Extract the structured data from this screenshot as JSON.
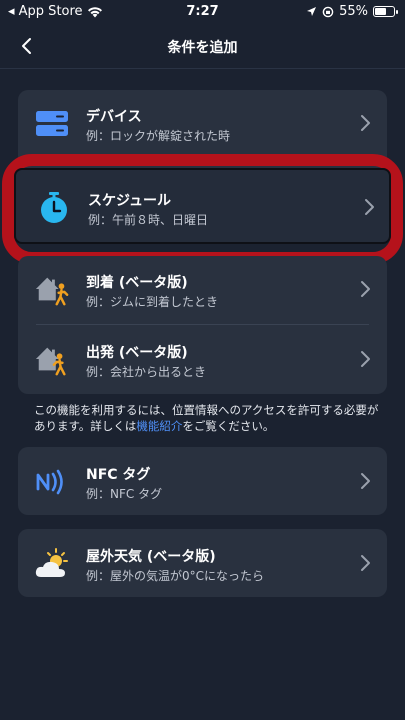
{
  "status_bar": {
    "carrier": "◂ App Store",
    "time": "7:27",
    "battery_percent": "55%",
    "battery_level": 0.55
  },
  "nav": {
    "title": "条件を追加",
    "back_icon": "chevron-left-icon"
  },
  "group1": [
    {
      "title": "デバイス",
      "subtitle": "例：ロックが解錠された時",
      "icon": "device-icon"
    }
  ],
  "highlighted": {
    "title": "スケジュール",
    "subtitle": "例：午前８時、日曜日",
    "icon": "stopwatch-icon"
  },
  "group2": [
    {
      "title": "到着 (ベータ版)",
      "subtitle": "例：ジムに到着したとき",
      "icon": "arrive-home-icon"
    },
    {
      "title": "出発 (ベータ版)",
      "subtitle": "例：会社から出るとき",
      "icon": "leave-home-icon"
    }
  ],
  "info": {
    "text_before": "この機能を利用するには、位置情報へのアクセスを許可する必要があります。詳しくは",
    "link": "機能紹介",
    "text_after": "をご覧ください。"
  },
  "nfc": {
    "title": "NFC タグ",
    "subtitle": "例：NFC タグ",
    "icon": "nfc-icon"
  },
  "weather": {
    "title": "屋外天気 (ベータ版)",
    "subtitle": "例：屋外の気温が0°Cになったら",
    "icon": "weather-icon"
  },
  "colors": {
    "background": "#1b2230",
    "card": "#29313f",
    "accent_blue": "#4f8ff7",
    "highlight_red": "#b5121b",
    "person_orange": "#f0a020"
  }
}
